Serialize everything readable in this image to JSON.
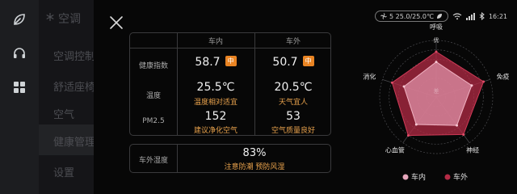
{
  "colors": {
    "accent": "#e98423",
    "interior": "#d98aa0",
    "exterior": "#b42b45"
  },
  "menu": {
    "title": "空调",
    "items": [
      "空调控制",
      "舒适座椅",
      "空气",
      "健康管理",
      "设置"
    ],
    "active_index": 3
  },
  "status": {
    "temp_text": "5 25.0/25.0℃",
    "time": "16:21",
    "icons": [
      "fan-icon",
      "leaf-icon",
      "wifi-icon",
      "signal-icon",
      "bluetooth-icon"
    ]
  },
  "table": {
    "headers": [
      "车内",
      "车外"
    ],
    "health": {
      "label": "健康指数",
      "in": "58.7",
      "out": "50.7",
      "in_badge": "中",
      "out_badge": "中"
    },
    "temp": {
      "label": "温度",
      "in": "25.5℃",
      "out": "20.5℃",
      "in_note": "温度相对适宜",
      "out_note": "天气宜人"
    },
    "pm": {
      "label": "PM2.5",
      "in": "152",
      "out": "53",
      "in_note": "建议净化空气",
      "out_note": "空气质量良好"
    }
  },
  "humidity": {
    "label": "车外湿度",
    "value": "83%",
    "note": "注意防潮 预防风湿"
  },
  "chart_data": {
    "type": "radar",
    "axes": [
      "呼吸",
      "免疫",
      "神经",
      "心血管",
      "消化"
    ],
    "top_label_line2": "优",
    "center_label": "差",
    "series": [
      {
        "name": "车内",
        "values": [
          0.62,
          0.66,
          0.62,
          0.6,
          0.6
        ]
      },
      {
        "name": "车外",
        "values": [
          0.8,
          0.88,
          0.82,
          0.84,
          0.82
        ]
      }
    ],
    "range": [
      0,
      1
    ],
    "legend": "bottom"
  }
}
